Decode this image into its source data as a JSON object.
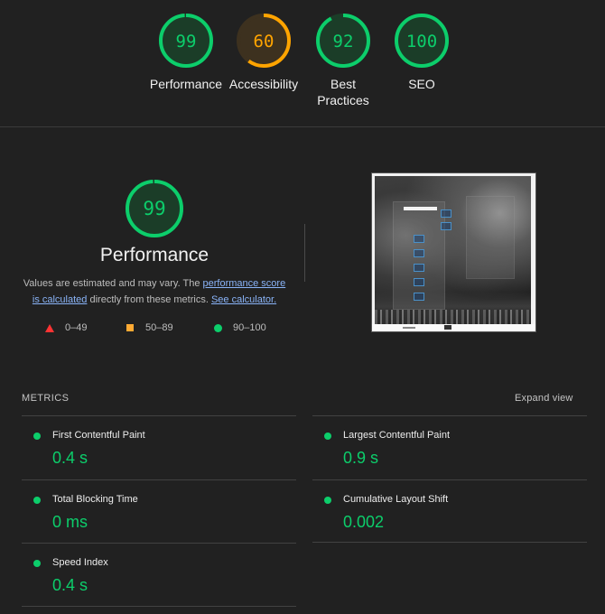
{
  "gauges": [
    {
      "score": "99",
      "label": "Performance",
      "color": "#0cce6b",
      "fill": 0.99
    },
    {
      "score": "60",
      "label": "Accessibility",
      "color": "#ffa400",
      "fill": 0.6
    },
    {
      "score": "92",
      "label": "Best Practices",
      "color": "#0cce6b",
      "fill": 0.92
    },
    {
      "score": "100",
      "label": "SEO",
      "color": "#0cce6b",
      "fill": 1.0
    }
  ],
  "performance": {
    "score": "99",
    "fill": 0.99,
    "title": "Performance",
    "desc_1": "Values are estimated and may vary. The ",
    "link_1": "performance score is calculated",
    "desc_2": " directly from these metrics. ",
    "link_2": "See calculator.",
    "legend": {
      "fail": "0–49",
      "average": "50–89",
      "pass": "90–100"
    }
  },
  "metrics": {
    "header": "METRICS",
    "expand_label": "Expand view",
    "items": [
      {
        "name": "First Contentful Paint",
        "value": "0.4 s"
      },
      {
        "name": "Largest Contentful Paint",
        "value": "0.9 s"
      },
      {
        "name": "Total Blocking Time",
        "value": "0 ms"
      },
      {
        "name": "Cumulative Layout Shift",
        "value": "0.002"
      },
      {
        "name": "Speed Index",
        "value": "0.4 s"
      }
    ]
  },
  "colors": {
    "pass": "#0cce6b",
    "average": "#ffa400",
    "fail": "#ff3333",
    "link": "#8ab4f8",
    "background": "#212121"
  }
}
